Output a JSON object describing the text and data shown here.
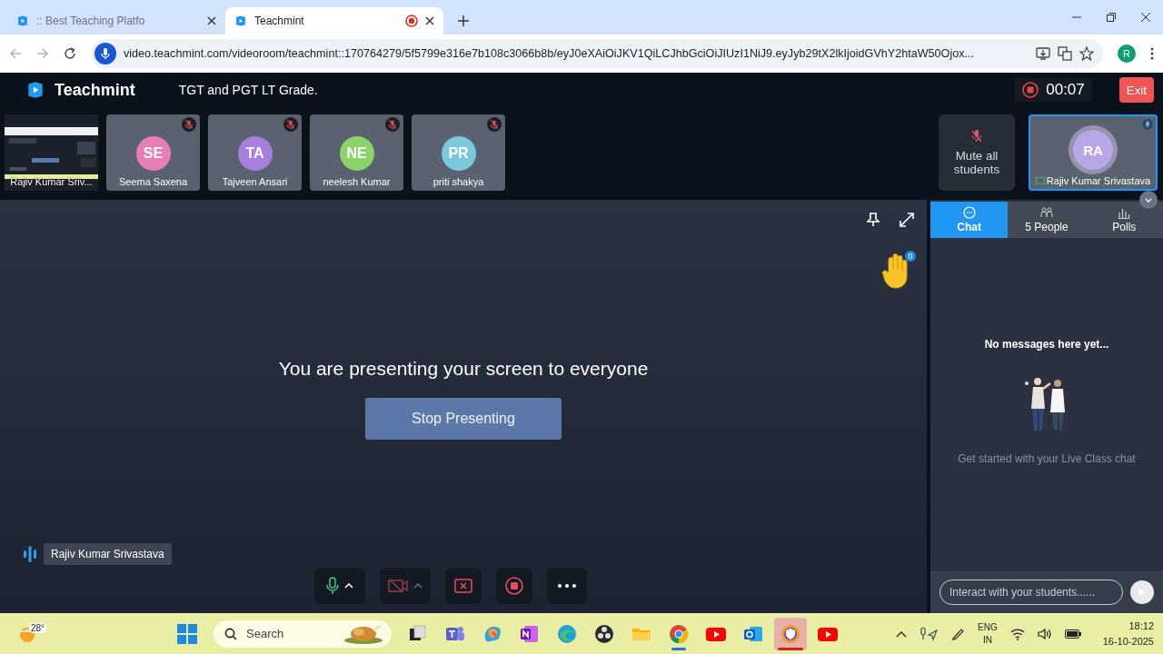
{
  "browser": {
    "tabs": [
      {
        "title": ":: Best Teaching Platfo",
        "selected": false,
        "recording": false
      },
      {
        "title": "Teachmint",
        "selected": true,
        "recording": true
      }
    ],
    "url": "video.teachmint.com/videoroom/teachmint::170764279/5f5799e316e7b108c3066b8b/eyJ0eXAiOiJKV1QiLCJhbGciOiJIUzI1NiJ9.eyJyb29tX2lkIjoidGVhY2htaW50Ojox...",
    "profile_initial": "R"
  },
  "app": {
    "brand": "Teachmint",
    "class_title": "TGT and PGT LT Grade.",
    "timer": "00:07",
    "exit": "Exit"
  },
  "participants": [
    {
      "kind": "screen",
      "name": "Rajiv Kumar Sriv...",
      "muted": false
    },
    {
      "kind": "avatar",
      "initials": "SE",
      "name": "Seema Saxena",
      "color": "#e77fb3",
      "muted": true
    },
    {
      "kind": "avatar",
      "initials": "TA",
      "name": "Tajveen Ansari",
      "color": "#a67fdc",
      "muted": true
    },
    {
      "kind": "avatar",
      "initials": "NE",
      "name": "neelesh Kumar",
      "color": "#8ed36a",
      "muted": true
    },
    {
      "kind": "avatar",
      "initials": "PR",
      "name": "priti shakya",
      "color": "#7cc9de",
      "muted": true
    }
  ],
  "mute_all": "Mute all students",
  "self_tile": {
    "initials": "RA",
    "name": "Rajiv Kumar Srivastava"
  },
  "stage": {
    "message": "You are presenting your screen to everyone",
    "button": "Stop Presenting",
    "hand_count": "0",
    "speaker": "Rajiv Kumar Srivastava"
  },
  "controls": [
    {
      "kind": "mic"
    },
    {
      "kind": "camera"
    },
    {
      "kind": "share"
    },
    {
      "kind": "record"
    },
    {
      "kind": "more"
    }
  ],
  "panel": {
    "tabs": [
      {
        "kind": "chat",
        "label": "Chat",
        "selected": true
      },
      {
        "kind": "people",
        "label": "5 People",
        "selected": false
      },
      {
        "kind": "polls",
        "label": "Polls",
        "selected": false
      }
    ],
    "empty_title": "No messages here yet...",
    "empty_hint": "Get started with your Live Class chat",
    "placeholder": "Interact with your students......"
  },
  "taskbar": {
    "weather": "28°",
    "search_placeholder": "Search",
    "apps": [
      {
        "kind": "taskview",
        "running": false,
        "selected": false
      },
      {
        "kind": "teams",
        "running": false,
        "selected": false
      },
      {
        "kind": "copilot",
        "running": false,
        "selected": false
      },
      {
        "kind": "onenote",
        "running": false,
        "selected": false
      },
      {
        "kind": "edge",
        "running": false,
        "selected": false
      },
      {
        "kind": "obs",
        "running": false,
        "selected": false
      },
      {
        "kind": "folder",
        "running": false,
        "selected": false
      },
      {
        "kind": "chrome",
        "running": true,
        "selected": false
      },
      {
        "kind": "youtube",
        "running": false,
        "selected": false
      },
      {
        "kind": "outlook",
        "running": false,
        "selected": false
      },
      {
        "kind": "shield",
        "running": true,
        "selected": true
      },
      {
        "kind": "youtube",
        "running": false,
        "selected": false
      }
    ],
    "lang": [
      "ENG",
      "IN"
    ],
    "time": "18:12",
    "date": "16-10-2025"
  }
}
